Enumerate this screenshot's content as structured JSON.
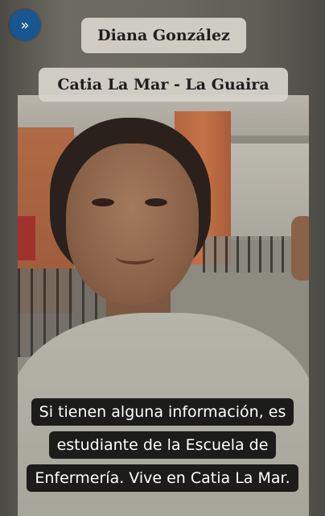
{
  "story": {
    "name": "Diana González",
    "location": "Catia La Mar - La Guaira",
    "caption_lines": [
      "Si tienen alguna información, es",
      "estudiante de la Escuela de",
      "Enfermería. Vive en Catia La Mar."
    ],
    "forward_icon": "»",
    "accent_color": "#17568f"
  }
}
